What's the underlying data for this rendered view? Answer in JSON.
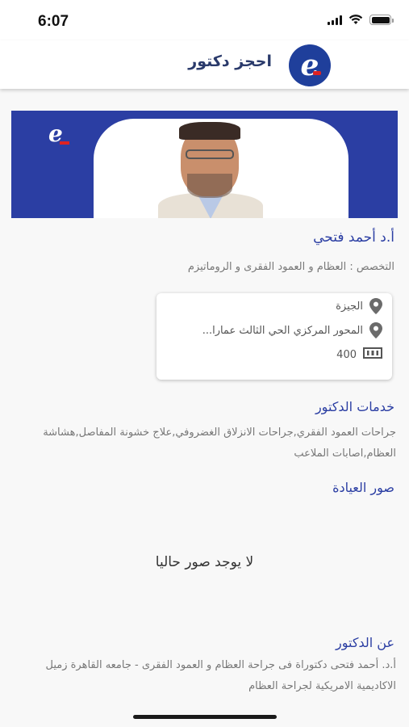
{
  "status": {
    "time": "6:07"
  },
  "appbar": {
    "title": "احجز دكتور",
    "logo_letter": "e"
  },
  "banner": {
    "logo_letter": "e"
  },
  "doctor": {
    "name": "أ.د  أحمد فتحي",
    "specialty": "التخصص : العظام و العمود الفقرى و الروماتيزم"
  },
  "card": {
    "city": "الجيزة",
    "address": "المحور المركزي الحي الثالث عمارا...",
    "price": "400"
  },
  "services": {
    "title": "خدمات الدكتور",
    "text": "جراحات العمود الفقري,جراحات الانزلاق الغضروفي,علاج خشونة المفاصل,هشاشة العظام,اصابات الملاعب"
  },
  "clinic_photos": {
    "title": "صور العيادة",
    "empty_text": "لا يوجد صور حاليا"
  },
  "about": {
    "title": "عن الدكتور",
    "text": "أ.د. أحمد فتحى  دكتوراة فى جراحة العظام و العمود الفقرى - جامعه القاهرة  زميل الاكاديمية الامريكية لجراحة العظام"
  },
  "colors": {
    "accent": "#2b3ea3",
    "banner": "#2b3ea3"
  }
}
